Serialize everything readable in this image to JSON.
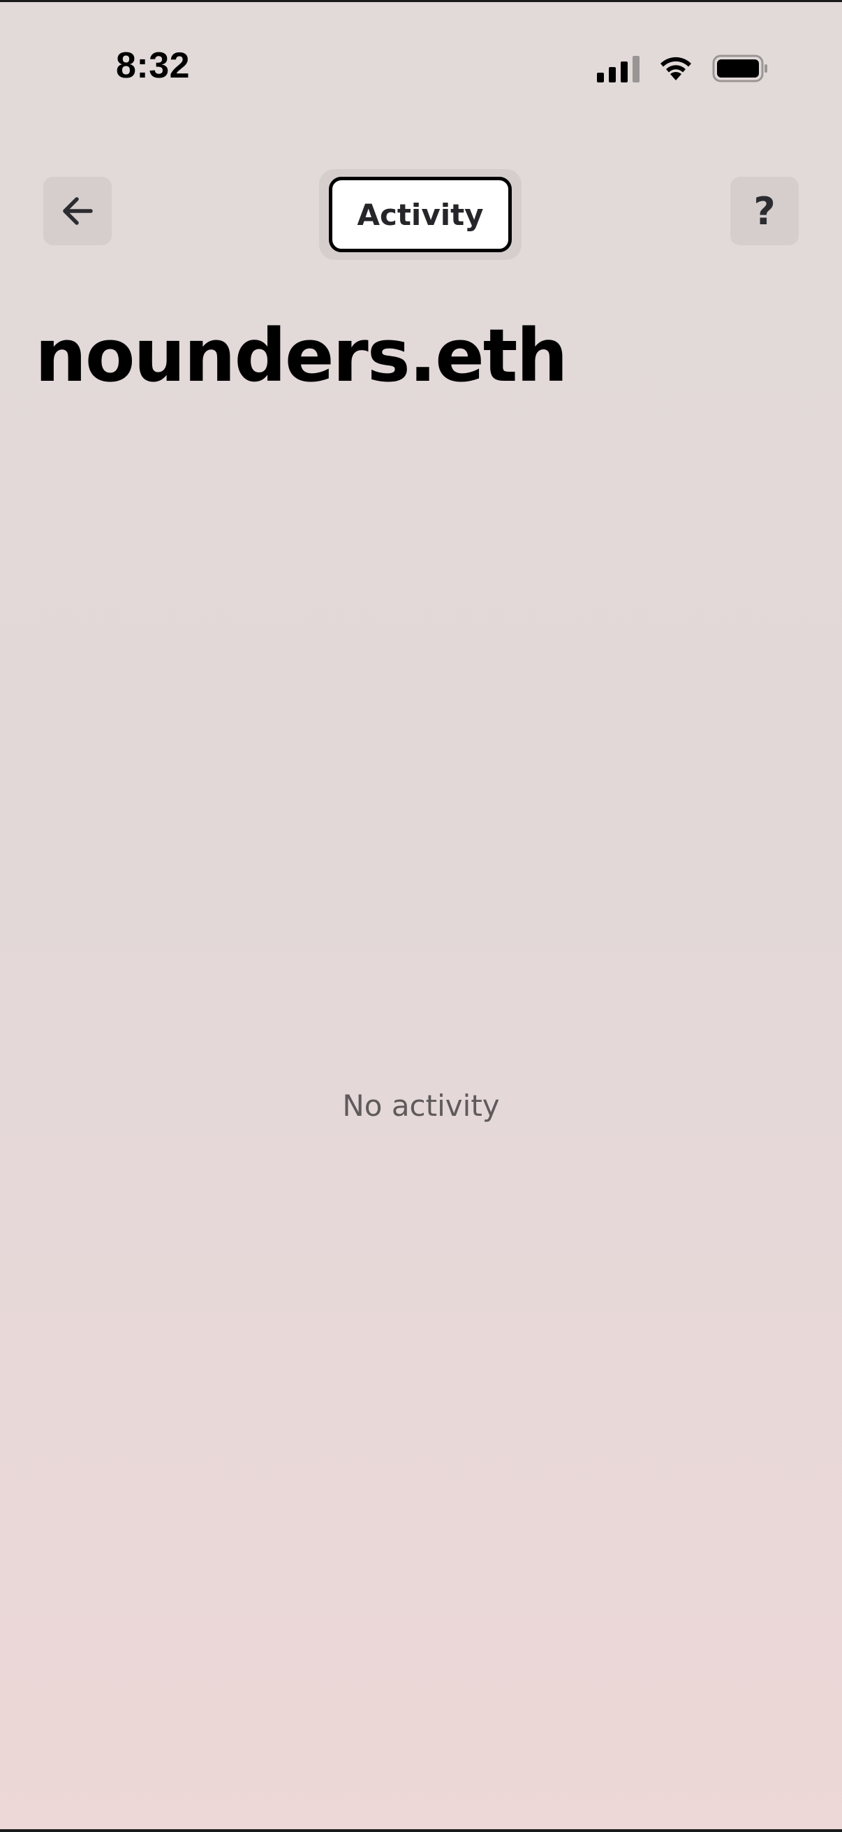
{
  "status_bar": {
    "time": "8:32"
  },
  "header": {
    "back_icon": "arrow-left-icon",
    "tab_label": "Activity",
    "help_label": "?"
  },
  "page": {
    "title": "nounders.eth",
    "empty_message": "No activity"
  },
  "colors": {
    "background_top": "#e1dad9",
    "background_bottom": "#edd7d7",
    "button_bg": "#d6cecd",
    "text_primary": "#000000",
    "text_muted": "#5f5a5b"
  }
}
